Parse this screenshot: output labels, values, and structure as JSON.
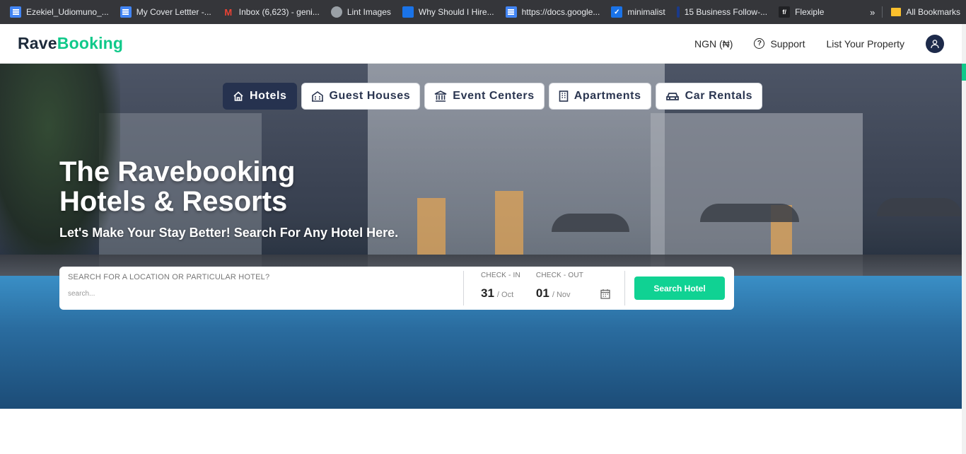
{
  "bookmarks": [
    {
      "label": "Ezekiel_Udiomuno_...",
      "icon": "docs-icon"
    },
    {
      "label": "My Cover Lettter -...",
      "icon": "docs-icon"
    },
    {
      "label": "Inbox (6,623) - geni...",
      "icon": "gmail-icon"
    },
    {
      "label": "Lint Images",
      "icon": "globe-icon"
    },
    {
      "label": "Why Should I Hire...",
      "icon": "site-icon"
    },
    {
      "label": "https://docs.google...",
      "icon": "docs-icon"
    },
    {
      "label": "minimalist",
      "icon": "check-icon"
    },
    {
      "label": "15 Business Follow-...",
      "icon": "site-icon"
    },
    {
      "label": "Flexiple",
      "icon": "flexiple-icon"
    }
  ],
  "bookmarks_more": "»",
  "all_bookmarks": "All Bookmarks",
  "nav": {
    "logo_part1": "Rave",
    "logo_part2": "Booking",
    "currency": "NGN (₦)",
    "support": "Support",
    "list_property": "List Your Property"
  },
  "tabs": [
    {
      "label": "Hotels",
      "icon": "home-icon",
      "active": true
    },
    {
      "label": "Guest Houses",
      "icon": "building-icon",
      "active": false
    },
    {
      "label": "Event Centers",
      "icon": "bank-icon",
      "active": false
    },
    {
      "label": "Apartments",
      "icon": "apartment-icon",
      "active": false
    },
    {
      "label": "Car Rentals",
      "icon": "car-icon",
      "active": false
    }
  ],
  "hero": {
    "title_line1": "The Ravebooking",
    "title_line2": "Hotels & Resorts",
    "subtitle": "Let's Make Your Stay Better! Search For Any Hotel Here."
  },
  "search": {
    "location_label": "SEARCH FOR A LOCATION OR PARTICULAR HOTEL?",
    "location_placeholder": "search...",
    "checkin_label": "CHECK - IN",
    "checkin_day": "31",
    "checkin_month": "/ Oct",
    "checkout_label": "CHECK - OUT",
    "checkout_day": "01",
    "checkout_month": "/ Nov",
    "button_label": "Search Hotel"
  },
  "colors": {
    "accent": "#10c98a",
    "navy": "#26324f",
    "button": "#10d293"
  }
}
